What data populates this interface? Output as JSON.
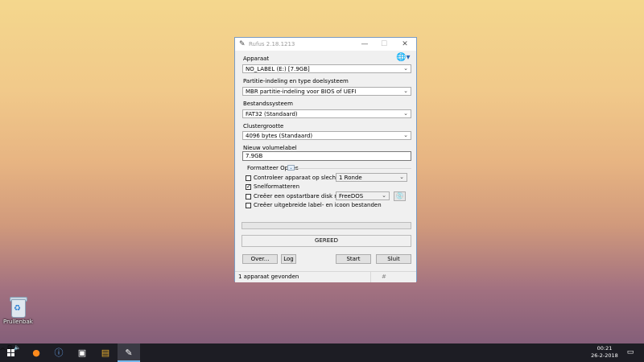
{
  "desktop": {
    "recycle_bin_label": "Prullenbak"
  },
  "window": {
    "title": "Rufus 2.18.1213",
    "controls": {
      "minimize": "—",
      "maximize": "☐",
      "close": "✕"
    },
    "device_label": "Apparaat",
    "device_value": "NO_LABEL (E:) [7.9GB]",
    "partition_label": "Partitie-indeling en type doelsysteem",
    "partition_value": "MBR partitie-indeling voor BIOS of UEFI",
    "filesystem_label": "Bestandssysteem",
    "filesystem_value": "FAT32 (Standaard)",
    "cluster_label": "Clustergrootte",
    "cluster_value": "4096 bytes (Standaard)",
    "volume_label_label": "Nieuw volumelabel",
    "volume_label_value": "7.9GB",
    "format_options_label": "Formatteer Opties",
    "options": {
      "check_device": "Controleer apparaat op slechte",
      "passes_value": "1 Ronde",
      "quick_format": "Snelformatteren",
      "bootable": "Creëer een opstartbare disk met",
      "boot_type_value": "FreeDOS",
      "extended_label": "Creëer uitgebreide label- en icoon bestanden"
    },
    "status": "GEREED",
    "buttons": {
      "about": "Over...",
      "log": "Log",
      "start": "Start",
      "close": "Sluit"
    },
    "statusbar": {
      "text": "1 apparaat gevonden",
      "hash": "#"
    }
  },
  "taskbar": {
    "clock_time": "00:21",
    "clock_date": "26-2-2018"
  },
  "colors": {
    "accent": "#76b9ed",
    "taskbar": "#1d1d24",
    "window_border": "#7a9cc4"
  }
}
